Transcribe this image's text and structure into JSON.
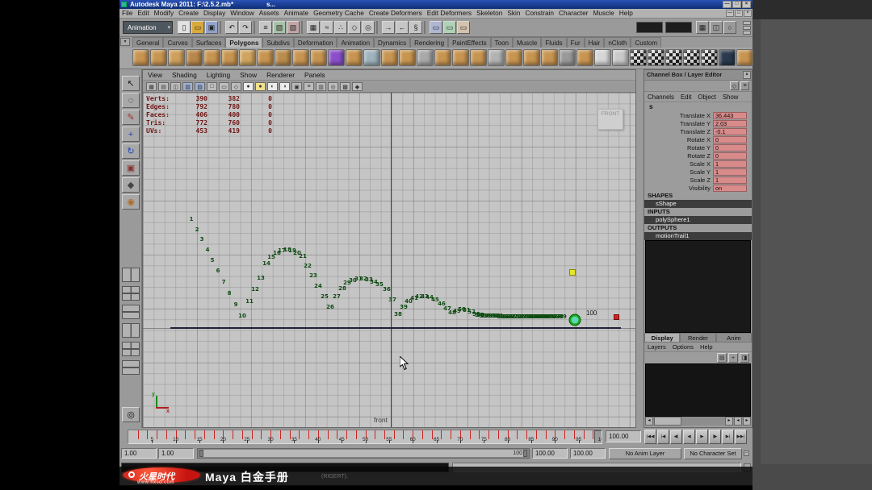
{
  "window": {
    "title": "Autodesk Maya 2011:  F:\\2.5.2.mb*",
    "tail": "s...",
    "controls": [
      "—",
      "□",
      "×"
    ]
  },
  "menus": [
    "File",
    "Edit",
    "Modify",
    "Create",
    "Display",
    "Window",
    "Assets",
    "Animate",
    "Geometry Cache",
    "Create Deformers",
    "Edit Deformers",
    "Skeleton",
    "Skin",
    "Constrain",
    "Character",
    "Muscle",
    "Help"
  ],
  "status": {
    "menuset": "Animation",
    "icons": [
      {
        "n": "new-scene-icon",
        "g": "▯",
        "c": "#e2e2e2"
      },
      {
        "n": "open-scene-icon",
        "g": "▭",
        "c": "#d9a93a"
      },
      {
        "n": "save-scene-icon",
        "g": "▣",
        "c": "#93a5cf"
      },
      {
        "n": "divider"
      },
      {
        "n": "undo-icon",
        "g": "↶",
        "c": "#c6c6c6"
      },
      {
        "n": "redo-icon",
        "g": "↷",
        "c": "#c6c6c6"
      },
      {
        "n": "divider"
      },
      {
        "n": "select-mode-hierarchy-icon",
        "g": "≡",
        "c": "#c6c6c6"
      },
      {
        "n": "select-mode-object-icon",
        "g": "▨",
        "c": "#a7c3a7"
      },
      {
        "n": "select-mode-component-icon",
        "g": "▧",
        "c": "#c3a7a7"
      },
      {
        "n": "divider"
      },
      {
        "n": "snap-grid-icon",
        "g": "▦",
        "c": "#c6c6c6"
      },
      {
        "n": "snap-curve-icon",
        "g": "≈",
        "c": "#c6c6c6"
      },
      {
        "n": "snap-point-icon",
        "g": "∴",
        "c": "#c6c6c6"
      },
      {
        "n": "snap-surface-icon",
        "g": "◇",
        "c": "#c6c6c6"
      },
      {
        "n": "snap-view-icon",
        "g": "◎",
        "c": "#c6c6c6"
      },
      {
        "n": "divider"
      },
      {
        "n": "input-connections-icon",
        "g": "→",
        "c": "#c6c6c6"
      },
      {
        "n": "output-connections-icon",
        "g": "←",
        "c": "#c6c6c6"
      },
      {
        "n": "construction-history-icon",
        "g": "§",
        "c": "#c6c6c6"
      },
      {
        "n": "divider"
      },
      {
        "n": "render-view-icon",
        "g": "▭",
        "c": "#aeb6d2"
      },
      {
        "n": "ipr-render-icon",
        "g": "▭",
        "c": "#aed2b6"
      },
      {
        "n": "render-settings-icon",
        "g": "▭",
        "c": "#d2c2ae"
      }
    ],
    "right_icons": [
      {
        "n": "grid-display-icon",
        "g": "▦"
      },
      {
        "n": "camera-lock-icon",
        "g": "◫"
      },
      {
        "n": "light-display-icon",
        "g": "○"
      }
    ]
  },
  "shelf": {
    "tabs": [
      "General",
      "Curves",
      "Surfaces",
      "Polygons",
      "Subdivs",
      "Deformation",
      "Animation",
      "Dynamics",
      "Rendering",
      "PaintEffects",
      "Toon",
      "Muscle",
      "Fluids",
      "Fur",
      "Hair",
      "nCloth",
      "Custom"
    ],
    "active": "Polygons",
    "icons": [
      "#c89551",
      "#c89551",
      "#cfa05c",
      "#b9874a",
      "#c89551",
      "#c89551",
      "#d0a560",
      "#c89551",
      "#bb8d4c",
      "#c89551",
      "#c89551",
      "#8b4fc9",
      "#c89551",
      "#9fb3bd",
      "#c89551",
      "#c89551",
      "#a9a9a9",
      "#c89551",
      "#c89551",
      "#c89551",
      "#b3b3b3",
      "#c89551",
      "#c89551",
      "#c89551",
      "#999999",
      "#c89551",
      "#d6d6d6",
      "#c9c9c9",
      "checker",
      "checker",
      "checker",
      "checker",
      "checker",
      "#2b3a4d",
      "#c89551"
    ]
  },
  "toolbox": {
    "tools": [
      {
        "name": "select-tool",
        "glyph": "↖",
        "color": "#1a1a1a"
      },
      {
        "name": "lasso-tool",
        "glyph": "◌",
        "color": "#1a1a1a"
      },
      {
        "name": "paint-select-tool",
        "glyph": "✎",
        "color": "#a23333"
      },
      {
        "name": "move-tool",
        "glyph": "+",
        "color": "#2244bb"
      },
      {
        "name": "rotate-tool",
        "glyph": "↻",
        "color": "#2244bb"
      },
      {
        "name": "scale-tool",
        "glyph": "▣",
        "color": "#8a3333"
      },
      {
        "name": "universal-manipulator-tool",
        "glyph": "◆",
        "color": "#444444"
      },
      {
        "name": "soft-mod-tool",
        "glyph": "◉",
        "color": "#b06a22"
      }
    ],
    "layouts": [
      "single-pane-layout",
      "four-pane-layout",
      "two-pane-side-layout",
      "two-pane-stacked-layout",
      "three-pane-layout",
      "outliner-persp-layout"
    ],
    "pan_glyph": "◎"
  },
  "panel": {
    "menus": [
      "View",
      "Shading",
      "Lighting",
      "Show",
      "Renderer",
      "Panels"
    ],
    "toolbar_icons": [
      {
        "g": "▦",
        "c": "#bcbcbc"
      },
      {
        "g": "▤",
        "c": "#bcbcbc"
      },
      {
        "g": "◫",
        "c": "#bcbcbc"
      },
      {
        "g": "▧",
        "c": "#9fb0d4"
      },
      {
        "g": "▨",
        "c": "#9fb0d4"
      },
      {
        "g": "□",
        "c": "#bcbcbc"
      },
      {
        "g": "▭",
        "c": "#bcbcbc"
      },
      {
        "g": "◇",
        "c": "#bcbcbc"
      },
      {
        "g": "●",
        "c": "#ececec"
      },
      {
        "g": "●",
        "c": "#f0e08a"
      },
      {
        "g": "◐",
        "c": "#ececec"
      },
      {
        "g": "◑",
        "c": "#ececec"
      },
      {
        "g": "▣",
        "c": "#bcbcbc"
      },
      {
        "g": "≡",
        "c": "#bcbcbc"
      },
      {
        "g": "▥",
        "c": "#bcbcbc"
      },
      {
        "g": "◎",
        "c": "#bcbcbc"
      },
      {
        "g": "▩",
        "c": "#bcbcbc"
      },
      {
        "g": "◆",
        "c": "#bcbcbc"
      }
    ],
    "hud": [
      [
        "Verts:",
        "390",
        "382",
        "0"
      ],
      [
        "Edges:",
        "792",
        "780",
        "0"
      ],
      [
        "Faces:",
        "406",
        "400",
        "0"
      ],
      [
        "Tris:",
        "772",
        "760",
        "0"
      ],
      [
        "UVs:",
        "453",
        "419",
        "0"
      ]
    ],
    "camera": "FRONT",
    "camera_lc": "front",
    "axis": {
      "x": "x",
      "y": "y"
    },
    "trail": {
      "end_label": "100",
      "points": [
        [
          1,
          237,
          272
        ],
        [
          2,
          244,
          285
        ],
        [
          3,
          250,
          297
        ],
        [
          4,
          257,
          310
        ],
        [
          5,
          263,
          323
        ],
        [
          6,
          270,
          336
        ],
        [
          7,
          277,
          350
        ],
        [
          8,
          284,
          364
        ],
        [
          9,
          292,
          378
        ],
        [
          10,
          300,
          392
        ],
        [
          11,
          309,
          374
        ],
        [
          12,
          316,
          359
        ],
        [
          13,
          323,
          345
        ],
        [
          14,
          330,
          327
        ],
        [
          15,
          336,
          319
        ],
        [
          16,
          343,
          314
        ],
        [
          17,
          349,
          311
        ],
        [
          18,
          356,
          310
        ],
        [
          19,
          362,
          311
        ],
        [
          20,
          368,
          314
        ],
        [
          21,
          375,
          318
        ],
        [
          22,
          381,
          330
        ],
        [
          23,
          388,
          342
        ],
        [
          24,
          394,
          355
        ],
        [
          25,
          402,
          368
        ],
        [
          26,
          409,
          381
        ],
        [
          27,
          417,
          368
        ],
        [
          28,
          424,
          358
        ],
        [
          29,
          430,
          351
        ],
        [
          30,
          437,
          348
        ],
        [
          31,
          444,
          346
        ],
        [
          32,
          450,
          346
        ],
        [
          33,
          457,
          347
        ],
        [
          34,
          463,
          350
        ],
        [
          35,
          470,
          353
        ],
        [
          36,
          479,
          359
        ],
        [
          37,
          486,
          372
        ],
        [
          38,
          493,
          390
        ],
        [
          39,
          500,
          381
        ],
        [
          40,
          506,
          374
        ],
        [
          41,
          513,
          370
        ],
        [
          42,
          519,
          368
        ],
        [
          43,
          526,
          368
        ],
        [
          44,
          532,
          369
        ],
        [
          45,
          539,
          372
        ],
        [
          46,
          547,
          377
        ],
        [
          47,
          554,
          383
        ],
        [
          48,
          560,
          388
        ],
        [
          49,
          566,
          386
        ],
        [
          50,
          572,
          384
        ],
        [
          51,
          578,
          385
        ],
        [
          52,
          584,
          387
        ],
        [
          53,
          590,
          390
        ],
        [
          54,
          593,
          391
        ],
        [
          55,
          595,
          391
        ],
        [
          56,
          598,
          392
        ],
        [
          57,
          600,
          392
        ],
        [
          58,
          603,
          392
        ],
        [
          59,
          605,
          392
        ],
        [
          60,
          608,
          392
        ],
        [
          61,
          610,
          392
        ],
        [
          62,
          613,
          392
        ],
        [
          63,
          615,
          392
        ],
        [
          64,
          618,
          392
        ],
        [
          65,
          620,
          393
        ],
        [
          66,
          623,
          393
        ],
        [
          67,
          625,
          393
        ],
        [
          68,
          627,
          393
        ],
        [
          69,
          630,
          393
        ],
        [
          70,
          632,
          393
        ],
        [
          71,
          634,
          393
        ],
        [
          72,
          637,
          393
        ],
        [
          73,
          639,
          393
        ],
        [
          74,
          641,
          393
        ],
        [
          75,
          644,
          393
        ],
        [
          76,
          646,
          393
        ],
        [
          77,
          648,
          393
        ],
        [
          78,
          650,
          393
        ],
        [
          79,
          652,
          393
        ],
        [
          80,
          655,
          393
        ],
        [
          81,
          657,
          393
        ],
        [
          82,
          659,
          393
        ],
        [
          83,
          661,
          393
        ],
        [
          84,
          663,
          393
        ],
        [
          85,
          665,
          393
        ],
        [
          86,
          667,
          393
        ],
        [
          87,
          669,
          393
        ],
        [
          88,
          671,
          393
        ],
        [
          89,
          673,
          393
        ],
        [
          90,
          675,
          393
        ],
        [
          91,
          677,
          393
        ],
        [
          92,
          679,
          393
        ],
        [
          93,
          681,
          393
        ],
        [
          94,
          683,
          393
        ],
        [
          95,
          685,
          393
        ],
        [
          96,
          687,
          393
        ],
        [
          97,
          690,
          393
        ],
        [
          98,
          693,
          393
        ],
        [
          99,
          697,
          393
        ]
      ]
    }
  },
  "channel_box": {
    "title": "Channel Box / Layer Editor",
    "menus": [
      "Channels",
      "Edit",
      "Object",
      "Show"
    ],
    "object": "s",
    "attrs": [
      {
        "label": "Translate X",
        "value": "36.443"
      },
      {
        "label": "Translate Y",
        "value": "2.03"
      },
      {
        "label": "Translate Z",
        "value": "-0.1"
      },
      {
        "label": "Rotate X",
        "value": "0"
      },
      {
        "label": "Rotate Y",
        "value": "0"
      },
      {
        "label": "Rotate Z",
        "value": "0"
      },
      {
        "label": "Scale X",
        "value": "1"
      },
      {
        "label": "Scale Y",
        "value": "1"
      },
      {
        "label": "Scale Z",
        "value": "1"
      },
      {
        "label": "Visibility",
        "value": "on"
      }
    ],
    "sections": [
      {
        "heading": "SHAPES",
        "node": "sShape"
      },
      {
        "heading": "INPUTS",
        "node": "polySphere1"
      },
      {
        "heading": "OUTPUTS",
        "node": "motionTrail1"
      }
    ]
  },
  "layer_editor": {
    "tabs": [
      "Display",
      "Render",
      "Anim"
    ],
    "active": "Display",
    "menus": [
      "Layers",
      "Options",
      "Help"
    ],
    "icons": [
      {
        "n": "new-empty-layer-icon",
        "g": "▤"
      },
      {
        "n": "new-layer-selected-icon",
        "g": "+"
      },
      {
        "n": "layer-options-icon",
        "g": "◨"
      }
    ]
  },
  "timeline": {
    "labels": [
      5,
      10,
      15,
      20,
      25,
      30,
      35,
      40,
      45,
      50,
      55,
      60,
      65,
      70,
      75,
      80,
      85,
      90,
      95,
      100
    ],
    "key_tick_step": 2,
    "current": "100.00",
    "playback": [
      "|◀◀",
      "|◀",
      "◀|",
      "◀",
      "▶",
      "|▶",
      "▶|",
      "▶▶|"
    ]
  },
  "range": {
    "min": "1.00",
    "min2": "1.00",
    "bar_label": "100",
    "max": "100.00",
    "max2": "100.00",
    "anim_layer": "No Anim Layer",
    "character_set": "No Character Set"
  },
  "ui": {
    "dropdown_arrow": "▾",
    "shelf_menu": "▾",
    "shelf_menu2": "▸",
    "scroll_left": "◂",
    "scroll_right": "▸",
    "close": "×",
    "mini_a": "−",
    "mini_b": "•",
    "cb_icon_a": "◇",
    "cb_icon_b": "≡"
  },
  "watermark": {
    "logo": "火星时代",
    "url": "www.hxsd.com",
    "title": "Maya 白金手册",
    "faint": "(RIGERT)."
  }
}
